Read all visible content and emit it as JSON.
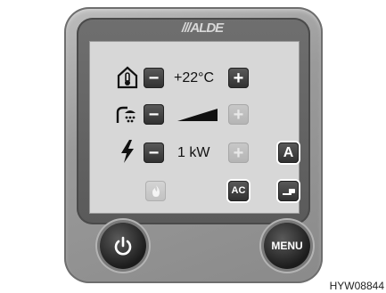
{
  "brand": "///ALDE",
  "rows": {
    "temperature": {
      "value": "+22°C",
      "minus": "−",
      "plus": "+"
    },
    "hot_water": {
      "minus": "−",
      "plus": "+"
    },
    "power": {
      "value": "1 kW",
      "minus": "−",
      "plus": "+"
    }
  },
  "buttons": {
    "auto": "A",
    "ac": "AC",
    "menu": "MENU"
  },
  "code": "HYW08844"
}
